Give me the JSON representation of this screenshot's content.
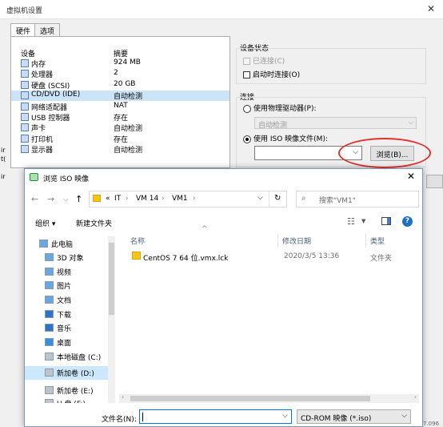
{
  "vm_settings": {
    "title": "虚拟机设置",
    "tabs": [
      "硬件",
      "选项"
    ],
    "columns": {
      "device": "设备",
      "summary": "摘要"
    },
    "devices": [
      {
        "name": "内存",
        "value": "924 MB",
        "icon": "memory-icon"
      },
      {
        "name": "处理器",
        "value": "2",
        "icon": "cpu-icon"
      },
      {
        "name": "硬盘 (SCSI)",
        "value": "20 GB",
        "icon": "hard-disk-icon"
      },
      {
        "name": "CD/DVD (IDE)",
        "value": "自动检测",
        "icon": "cd-dvd-icon"
      },
      {
        "name": "网络适配器",
        "value": "NAT",
        "icon": "network-adapter-icon"
      },
      {
        "name": "USB 控制器",
        "value": "存在",
        "icon": "usb-icon"
      },
      {
        "name": "声卡",
        "value": "自动检测",
        "icon": "sound-card-icon"
      },
      {
        "name": "打印机",
        "value": "存在",
        "icon": "printer-icon"
      },
      {
        "name": "显示器",
        "value": "自动检测",
        "icon": "display-icon"
      }
    ],
    "selected_device": 3,
    "device_status": {
      "title": "设备状态",
      "connected": "已连接(C)",
      "connect_on_start": "启动时连接(O)"
    },
    "connection": {
      "title": "连接",
      "physical_drive": "使用物理驱动器(P):",
      "physical_value": "自动检测",
      "use_iso": "使用 ISO 映像文件(M):",
      "browse": "浏览(B)..."
    },
    "side_fragments": [
      "ir",
      "t(",
      "ir"
    ],
    "bottom_fragment": "7.096"
  },
  "dialog": {
    "title": "浏览 ISO 映像",
    "breadcrumb": [
      "«",
      "IT",
      "VM 14",
      "VM1"
    ],
    "search_placeholder": "搜索\"VM1\"",
    "organize": "组织 ▾",
    "new_folder": "新建文件夹",
    "columns": {
      "name": "名称",
      "modified": "修改日期",
      "type": "类型"
    },
    "nav": [
      {
        "label": "此电脑",
        "icon": "this-pc-icon",
        "level": 0
      },
      {
        "label": "3D 对象",
        "icon": "3d-objects-icon",
        "level": 1
      },
      {
        "label": "视频",
        "icon": "videos-icon",
        "level": 1
      },
      {
        "label": "图片",
        "icon": "pictures-icon",
        "level": 1
      },
      {
        "label": "文档",
        "icon": "documents-icon",
        "level": 1
      },
      {
        "label": "下载",
        "icon": "downloads-icon",
        "level": 1
      },
      {
        "label": "音乐",
        "icon": "music-icon",
        "level": 1
      },
      {
        "label": "桌面",
        "icon": "desktop-icon",
        "level": 1
      },
      {
        "label": "本地磁盘 (C:)",
        "icon": "local-disk-icon",
        "level": 1
      },
      {
        "label": "新加卷 (D:)",
        "icon": "drive-icon",
        "level": 1
      },
      {
        "label": "新加卷 (E:)",
        "icon": "drive-icon",
        "level": 1
      },
      {
        "label": "U 盘 (F:)",
        "icon": "usb-drive-icon",
        "level": 1
      }
    ],
    "selected_nav": 9,
    "files": [
      {
        "name": "CentOS 7 64 位.vmx.lck",
        "modified": "2020/3/5 13:36",
        "type": "文件夹"
      }
    ],
    "filename_label": "文件名(N):",
    "filename_value": "",
    "filetype": "CD-ROM 映像 (*.iso)"
  },
  "colors": {
    "accent": "#0078d7",
    "annotation": "#e0312b",
    "folder": "#f5c518"
  }
}
